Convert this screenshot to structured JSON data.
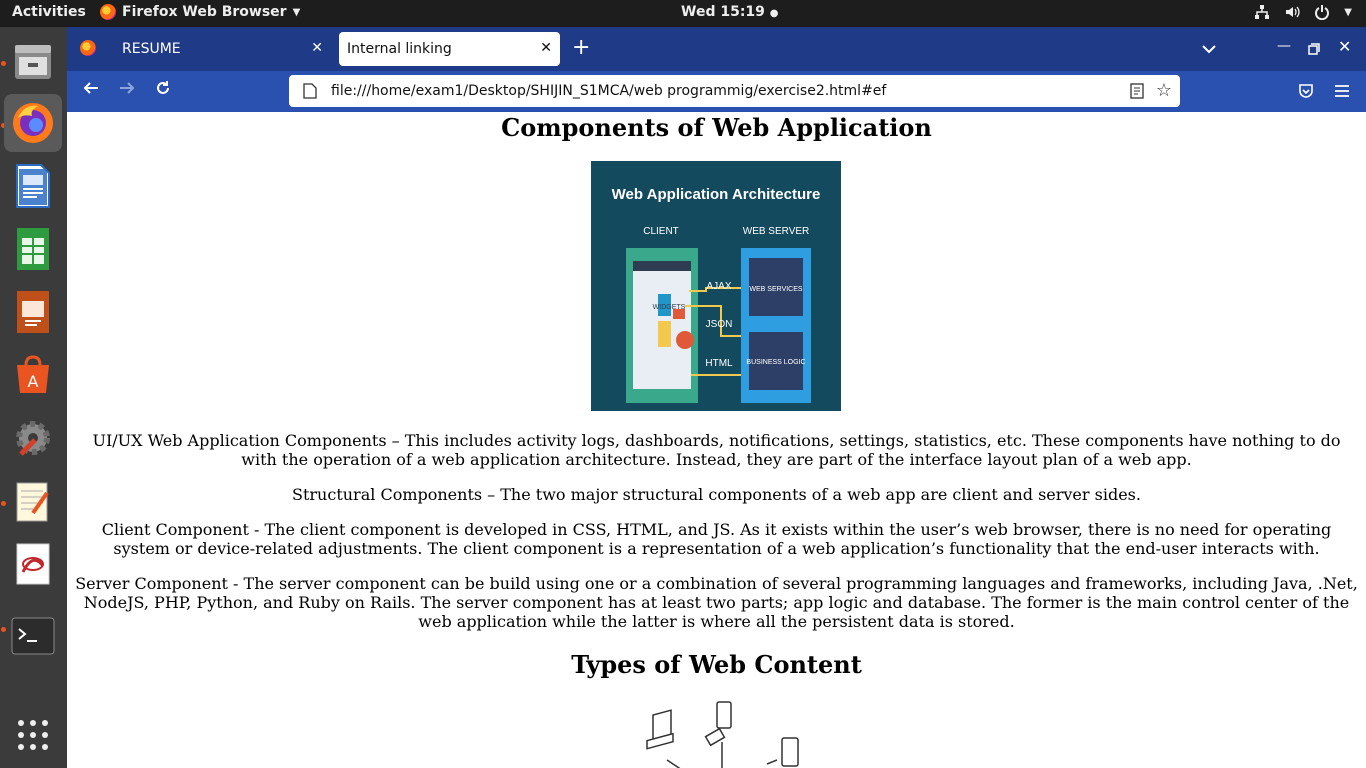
{
  "topbar": {
    "activities": "Activities",
    "app_name": "Firefox Web Browser",
    "clock": "Wed 15:19"
  },
  "tabs": [
    {
      "label": "RESUME"
    },
    {
      "label": "Internal linking"
    }
  ],
  "url": "file:///home/exam1/Desktop/SHIJIN_S1MCA/web programmig/exercise2.html#ef",
  "page": {
    "heading1": "Components of Web Application",
    "image1": {
      "title": "Web Application Architecture",
      "client": "CLIENT",
      "server": "WEB SERVER",
      "widgets": "WIDGETS",
      "ajax": "AJAX",
      "json": "JSON",
      "html": "HTML",
      "web_services": "WEB SERVICES",
      "business_logic": "BUSINESS LOGIC"
    },
    "para1": "UI/UX Web Application Components – This includes activity logs, dashboards, notifications, settings, statistics, etc. These components have nothing to do with the operation of a web application architecture. Instead, they are part of the interface layout plan of a web app.",
    "para2": "Structural Components – The two major structural components of a web app are client and server sides.",
    "para3": "Client Component - The client component is developed in CSS, HTML, and JS. As it exists within the user’s web browser, there is no need for operating system or device-related adjustments. The client component is a representation of a web application’s functionality that the end-user interacts with.",
    "para4": "Server Component - The server component can be build using one or a combination of several programming languages and frameworks, including Java, .Net, NodeJS, PHP, Python, and Ruby on Rails. The server component has at least two parts; app logic and database. The former is the main control center of the web application while the latter is where all the persistent data is stored.",
    "heading2": "Types of Web Content"
  },
  "colors": {
    "tabbar": "#1f3a86",
    "navbar": "#2b51b0",
    "dock": "#3b3b3b",
    "topbar": "#1d1d1d",
    "accent": "#e95420"
  },
  "icons": {
    "dock": [
      "file-manager-icon",
      "firefox-icon",
      "writer-icon",
      "calc-icon",
      "impress-icon",
      "software-icon",
      "settings-icon",
      "text-editor-icon",
      "document-viewer-icon",
      "terminal-icon",
      "app-grid-icon"
    ]
  }
}
